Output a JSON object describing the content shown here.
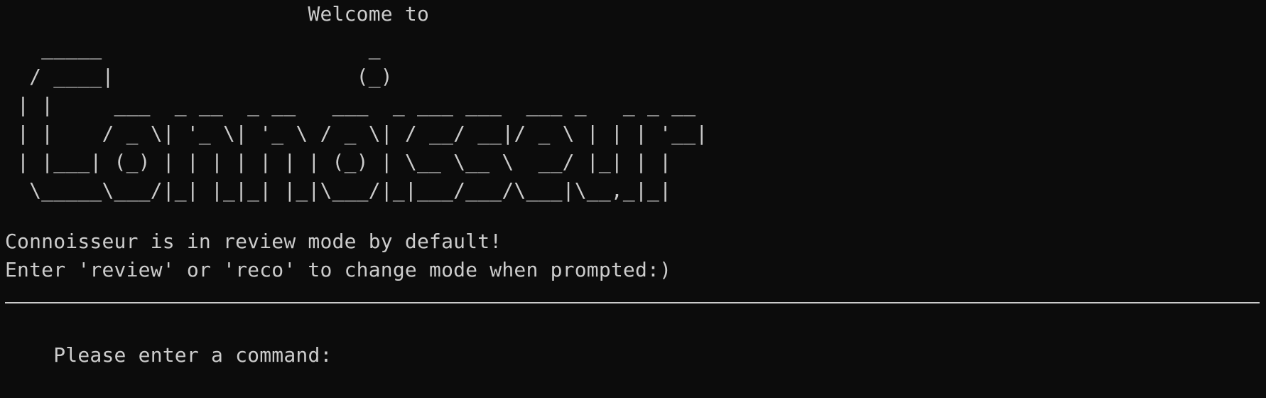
{
  "terminal": {
    "welcome_line": "                         Welcome to",
    "banner_lines": [
      "   _____                      _",
      "  / ____|                    (_)",
      " | |     ___  _ __  _ __   ___  _ ___ ___  ___ _   _ _ __",
      " | |    / _ \\| '_ \\| '_ \\ / _ \\| / __/ __|/ _ \\ | | | '__|",
      " | |___| (_) | | | | | | | (_) | \\__ \\__ \\  __/ |_| | |",
      "  \\_____\\___/|_| |_|_| |_|\\___/|_|___/___/\\___|\\__,_|_|"
    ],
    "info_line_1": "Connoisseur is in review mode by default!",
    "info_line_2": "Enter 'review' or 'reco' to change mode when prompted:)",
    "prompt": "Please enter a command: "
  }
}
